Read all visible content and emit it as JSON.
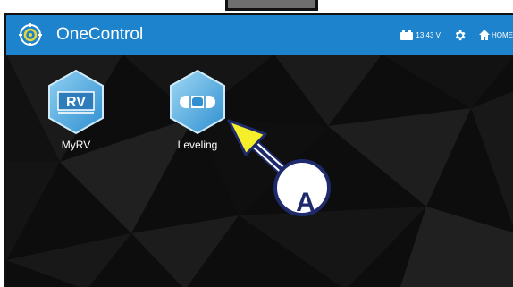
{
  "header": {
    "title": "OneControl",
    "battery_voltage": "13.43 V",
    "home_label": "HOME",
    "bar_color": "#1d83cc"
  },
  "apps": [
    {
      "label": "MyRV",
      "icon": "rv-icon",
      "logo_text": "RV"
    },
    {
      "label": "Leveling",
      "icon": "level-icon"
    }
  ],
  "callout": {
    "letter": "A",
    "arrow_color": "#f4ef2a",
    "circle_color": "#1e2a6b"
  }
}
